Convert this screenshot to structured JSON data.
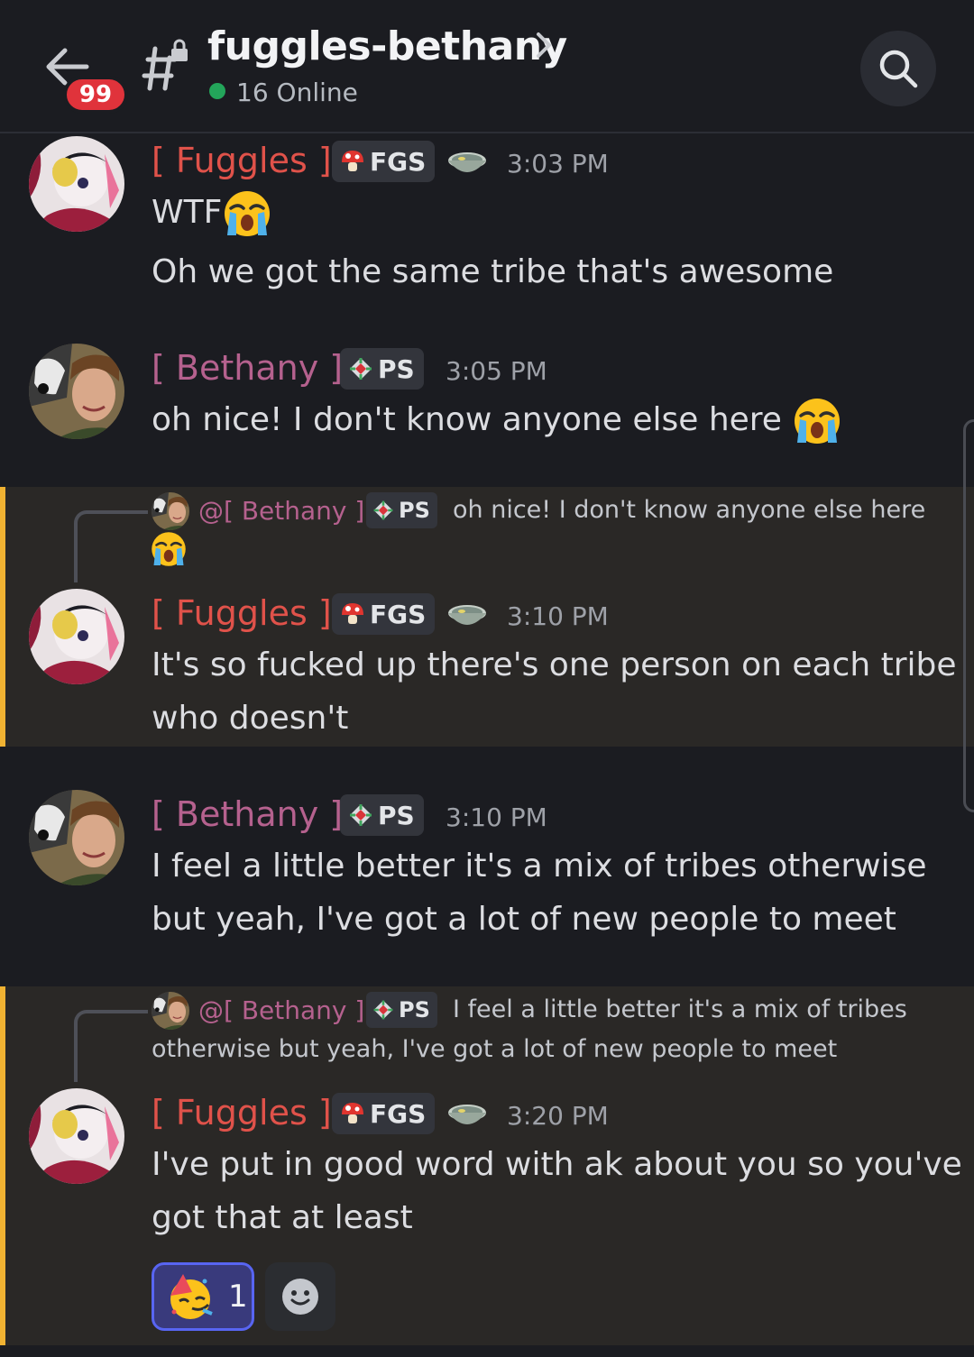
{
  "header": {
    "unread_count": "99",
    "channel_name": "fuggles-bethany",
    "online_text": "16 Online"
  },
  "users": {
    "fuggles": {
      "name": "[ Fuggles ]",
      "tag": "FGS",
      "color": "#e0524a"
    },
    "bethany": {
      "name": "[ Bethany ]",
      "tag": "PS",
      "color": "#b5618e"
    }
  },
  "messages": [
    {
      "author": "fuggles",
      "time": "3:03 PM",
      "lines": [
        "WTF",
        "Oh we got the same tribe that's awesome"
      ]
    },
    {
      "author": "bethany",
      "time": "3:05 PM",
      "lines": [
        "oh nice! I don't know anyone else here"
      ]
    },
    {
      "author": "fuggles",
      "time": "3:10 PM",
      "reply": {
        "name": "@[ Bethany ]",
        "tag": "PS",
        "text": "oh nice! I don't know anyone else here"
      },
      "lines": [
        "It's so fucked up there's one person on each tribe",
        "who doesn't"
      ]
    },
    {
      "author": "bethany",
      "time": "3:10 PM",
      "lines": [
        "I feel a little better it's a mix of tribes otherwise",
        "but yeah, I've got a lot of new people to meet"
      ]
    },
    {
      "author": "fuggles",
      "time": "3:20 PM",
      "reply": {
        "name": "@[ Bethany ]",
        "tag": "PS",
        "lines": [
          "I feel a little better it's a mix of tribes",
          "otherwise but yeah, I've got a lot of new people to meet"
        ]
      },
      "lines": [
        "I've put in good word with ak about you so you've",
        "got that at least"
      ],
      "reaction": {
        "emoji": "party-face-icon",
        "count": "1"
      }
    }
  ],
  "colors": {
    "accent": "#f0b232",
    "online": "#23a55a",
    "badge": "#e0333b",
    "reaction_border": "#5865f2"
  }
}
